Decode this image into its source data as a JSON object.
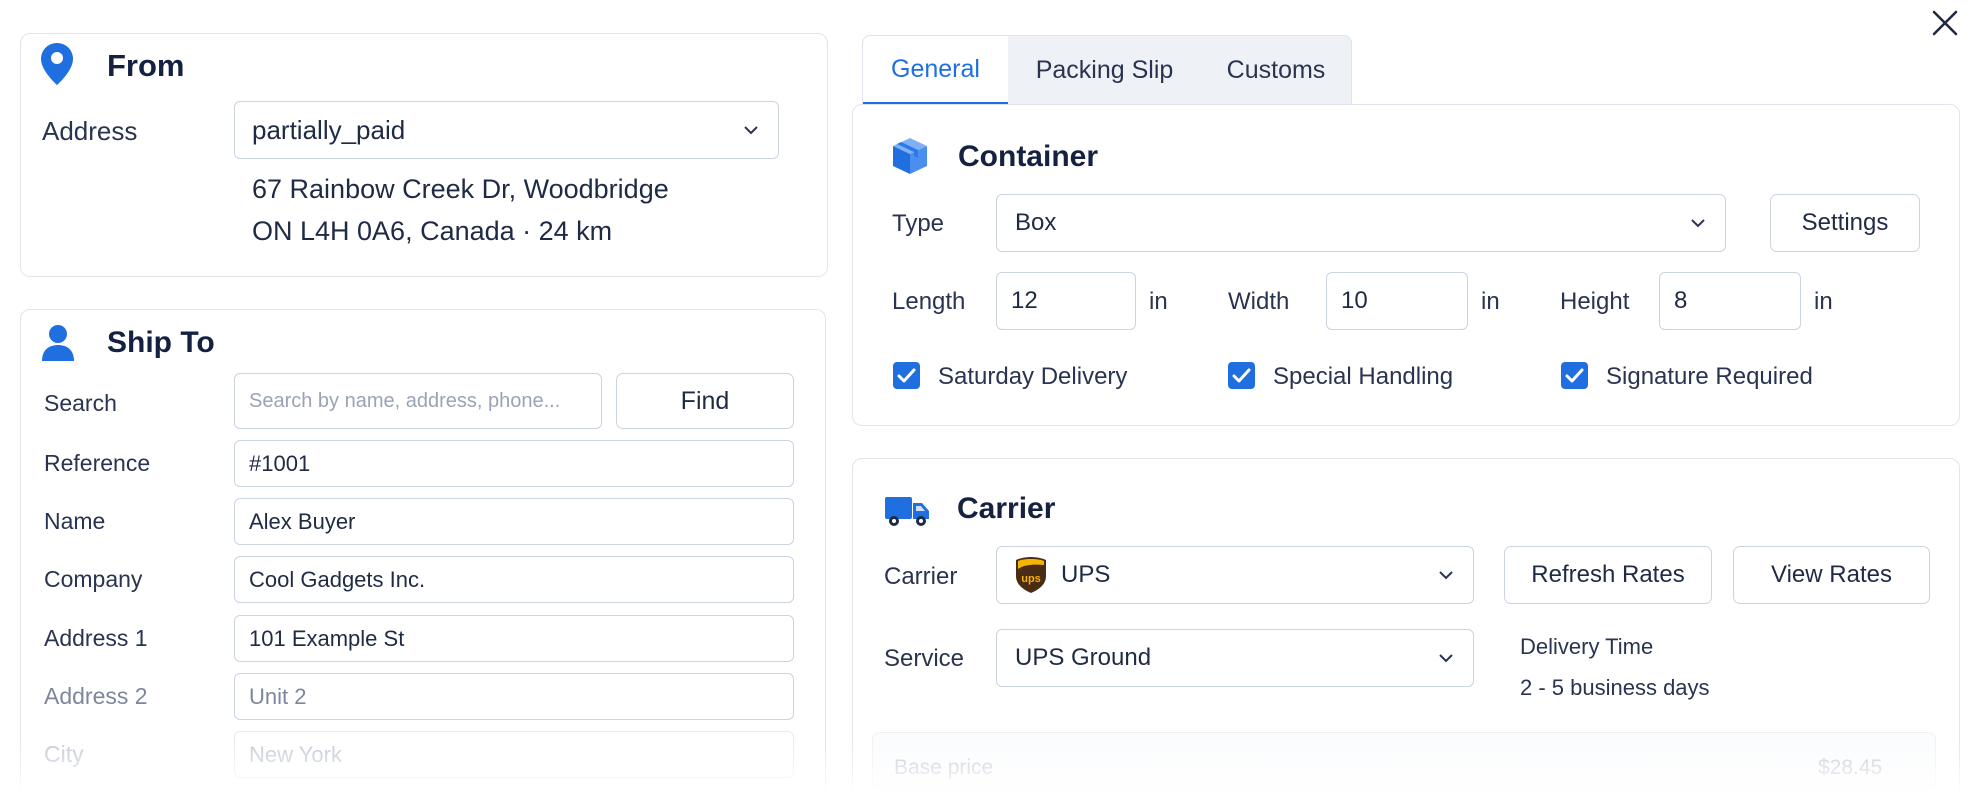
{
  "from": {
    "title": "From",
    "address_label": "Address",
    "address_select": "partially_paid",
    "address_line1": "67 Rainbow Creek Dr, Woodbridge",
    "address_line2": "ON L4H 0A6, Canada · 24 km"
  },
  "ship_to": {
    "title": "Ship To",
    "search_label": "Search",
    "search_placeholder": "Search by name, address, phone...",
    "find_button": "Find",
    "fields": [
      {
        "label": "Reference",
        "value": "#1001"
      },
      {
        "label": "Name",
        "value": "Alex Buyer"
      },
      {
        "label": "Company",
        "value": "Cool Gadgets Inc."
      },
      {
        "label": "Address 1",
        "value": "101 Example St"
      },
      {
        "label": "Address 2",
        "value": "Unit 2"
      },
      {
        "label": "City",
        "value": "New York"
      }
    ]
  },
  "tabs": [
    "General",
    "Packing Slip",
    "Customs"
  ],
  "container": {
    "title": "Container",
    "type_label": "Type",
    "type_value": "Box",
    "settings_button": "Settings",
    "length_label": "Length",
    "length_value": "12",
    "width_label": "Width",
    "width_value": "10",
    "height_label": "Height",
    "height_value": "8",
    "unit": "in",
    "options": [
      "Saturday Delivery",
      "Special Handling",
      "Signature Required"
    ]
  },
  "carrier": {
    "title": "Carrier",
    "carrier_label": "Carrier",
    "carrier_value": "UPS",
    "carrier_logo_text": "ups",
    "refresh_button": "Refresh Rates",
    "view_button": "View Rates",
    "service_label": "Service",
    "service_value": "UPS Ground",
    "delivery_label": "Delivery Time",
    "delivery_value": "2 - 5 business days",
    "base_price_label": "Base price",
    "base_price_value": "$28.45"
  },
  "colors": {
    "accent": "#1f6fe0",
    "text": "#1f2a44",
    "border": "#ccd3e1"
  }
}
